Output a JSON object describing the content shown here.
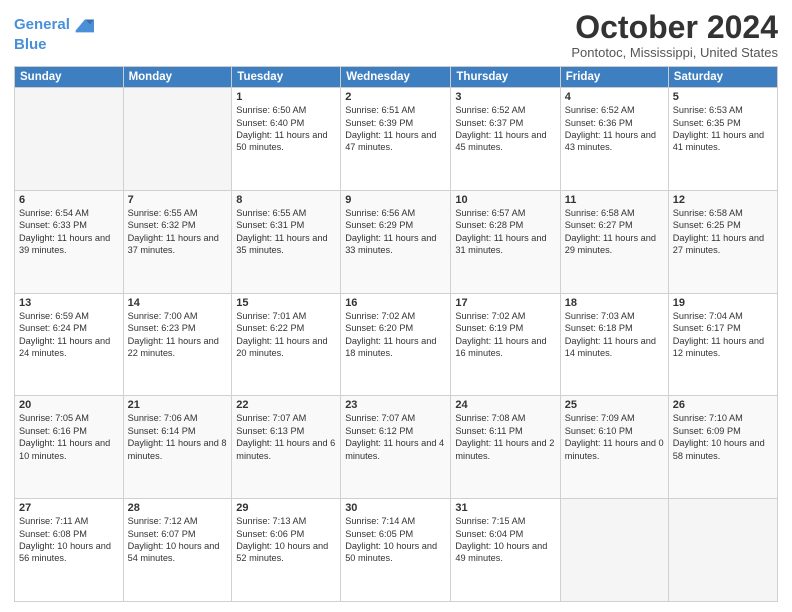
{
  "logo": {
    "line1": "General",
    "line2": "Blue"
  },
  "title": "October 2024",
  "location": "Pontotoc, Mississippi, United States",
  "weekdays": [
    "Sunday",
    "Monday",
    "Tuesday",
    "Wednesday",
    "Thursday",
    "Friday",
    "Saturday"
  ],
  "weeks": [
    [
      {
        "day": "",
        "sunrise": "",
        "sunset": "",
        "daylight": ""
      },
      {
        "day": "",
        "sunrise": "",
        "sunset": "",
        "daylight": ""
      },
      {
        "day": "1",
        "sunrise": "Sunrise: 6:50 AM",
        "sunset": "Sunset: 6:40 PM",
        "daylight": "Daylight: 11 hours and 50 minutes."
      },
      {
        "day": "2",
        "sunrise": "Sunrise: 6:51 AM",
        "sunset": "Sunset: 6:39 PM",
        "daylight": "Daylight: 11 hours and 47 minutes."
      },
      {
        "day": "3",
        "sunrise": "Sunrise: 6:52 AM",
        "sunset": "Sunset: 6:37 PM",
        "daylight": "Daylight: 11 hours and 45 minutes."
      },
      {
        "day": "4",
        "sunrise": "Sunrise: 6:52 AM",
        "sunset": "Sunset: 6:36 PM",
        "daylight": "Daylight: 11 hours and 43 minutes."
      },
      {
        "day": "5",
        "sunrise": "Sunrise: 6:53 AM",
        "sunset": "Sunset: 6:35 PM",
        "daylight": "Daylight: 11 hours and 41 minutes."
      }
    ],
    [
      {
        "day": "6",
        "sunrise": "Sunrise: 6:54 AM",
        "sunset": "Sunset: 6:33 PM",
        "daylight": "Daylight: 11 hours and 39 minutes."
      },
      {
        "day": "7",
        "sunrise": "Sunrise: 6:55 AM",
        "sunset": "Sunset: 6:32 PM",
        "daylight": "Daylight: 11 hours and 37 minutes."
      },
      {
        "day": "8",
        "sunrise": "Sunrise: 6:55 AM",
        "sunset": "Sunset: 6:31 PM",
        "daylight": "Daylight: 11 hours and 35 minutes."
      },
      {
        "day": "9",
        "sunrise": "Sunrise: 6:56 AM",
        "sunset": "Sunset: 6:29 PM",
        "daylight": "Daylight: 11 hours and 33 minutes."
      },
      {
        "day": "10",
        "sunrise": "Sunrise: 6:57 AM",
        "sunset": "Sunset: 6:28 PM",
        "daylight": "Daylight: 11 hours and 31 minutes."
      },
      {
        "day": "11",
        "sunrise": "Sunrise: 6:58 AM",
        "sunset": "Sunset: 6:27 PM",
        "daylight": "Daylight: 11 hours and 29 minutes."
      },
      {
        "day": "12",
        "sunrise": "Sunrise: 6:58 AM",
        "sunset": "Sunset: 6:25 PM",
        "daylight": "Daylight: 11 hours and 27 minutes."
      }
    ],
    [
      {
        "day": "13",
        "sunrise": "Sunrise: 6:59 AM",
        "sunset": "Sunset: 6:24 PM",
        "daylight": "Daylight: 11 hours and 24 minutes."
      },
      {
        "day": "14",
        "sunrise": "Sunrise: 7:00 AM",
        "sunset": "Sunset: 6:23 PM",
        "daylight": "Daylight: 11 hours and 22 minutes."
      },
      {
        "day": "15",
        "sunrise": "Sunrise: 7:01 AM",
        "sunset": "Sunset: 6:22 PM",
        "daylight": "Daylight: 11 hours and 20 minutes."
      },
      {
        "day": "16",
        "sunrise": "Sunrise: 7:02 AM",
        "sunset": "Sunset: 6:20 PM",
        "daylight": "Daylight: 11 hours and 18 minutes."
      },
      {
        "day": "17",
        "sunrise": "Sunrise: 7:02 AM",
        "sunset": "Sunset: 6:19 PM",
        "daylight": "Daylight: 11 hours and 16 minutes."
      },
      {
        "day": "18",
        "sunrise": "Sunrise: 7:03 AM",
        "sunset": "Sunset: 6:18 PM",
        "daylight": "Daylight: 11 hours and 14 minutes."
      },
      {
        "day": "19",
        "sunrise": "Sunrise: 7:04 AM",
        "sunset": "Sunset: 6:17 PM",
        "daylight": "Daylight: 11 hours and 12 minutes."
      }
    ],
    [
      {
        "day": "20",
        "sunrise": "Sunrise: 7:05 AM",
        "sunset": "Sunset: 6:16 PM",
        "daylight": "Daylight: 11 hours and 10 minutes."
      },
      {
        "day": "21",
        "sunrise": "Sunrise: 7:06 AM",
        "sunset": "Sunset: 6:14 PM",
        "daylight": "Daylight: 11 hours and 8 minutes."
      },
      {
        "day": "22",
        "sunrise": "Sunrise: 7:07 AM",
        "sunset": "Sunset: 6:13 PM",
        "daylight": "Daylight: 11 hours and 6 minutes."
      },
      {
        "day": "23",
        "sunrise": "Sunrise: 7:07 AM",
        "sunset": "Sunset: 6:12 PM",
        "daylight": "Daylight: 11 hours and 4 minutes."
      },
      {
        "day": "24",
        "sunrise": "Sunrise: 7:08 AM",
        "sunset": "Sunset: 6:11 PM",
        "daylight": "Daylight: 11 hours and 2 minutes."
      },
      {
        "day": "25",
        "sunrise": "Sunrise: 7:09 AM",
        "sunset": "Sunset: 6:10 PM",
        "daylight": "Daylight: 11 hours and 0 minutes."
      },
      {
        "day": "26",
        "sunrise": "Sunrise: 7:10 AM",
        "sunset": "Sunset: 6:09 PM",
        "daylight": "Daylight: 10 hours and 58 minutes."
      }
    ],
    [
      {
        "day": "27",
        "sunrise": "Sunrise: 7:11 AM",
        "sunset": "Sunset: 6:08 PM",
        "daylight": "Daylight: 10 hours and 56 minutes."
      },
      {
        "day": "28",
        "sunrise": "Sunrise: 7:12 AM",
        "sunset": "Sunset: 6:07 PM",
        "daylight": "Daylight: 10 hours and 54 minutes."
      },
      {
        "day": "29",
        "sunrise": "Sunrise: 7:13 AM",
        "sunset": "Sunset: 6:06 PM",
        "daylight": "Daylight: 10 hours and 52 minutes."
      },
      {
        "day": "30",
        "sunrise": "Sunrise: 7:14 AM",
        "sunset": "Sunset: 6:05 PM",
        "daylight": "Daylight: 10 hours and 50 minutes."
      },
      {
        "day": "31",
        "sunrise": "Sunrise: 7:15 AM",
        "sunset": "Sunset: 6:04 PM",
        "daylight": "Daylight: 10 hours and 49 minutes."
      },
      {
        "day": "",
        "sunrise": "",
        "sunset": "",
        "daylight": ""
      },
      {
        "day": "",
        "sunrise": "",
        "sunset": "",
        "daylight": ""
      }
    ]
  ]
}
